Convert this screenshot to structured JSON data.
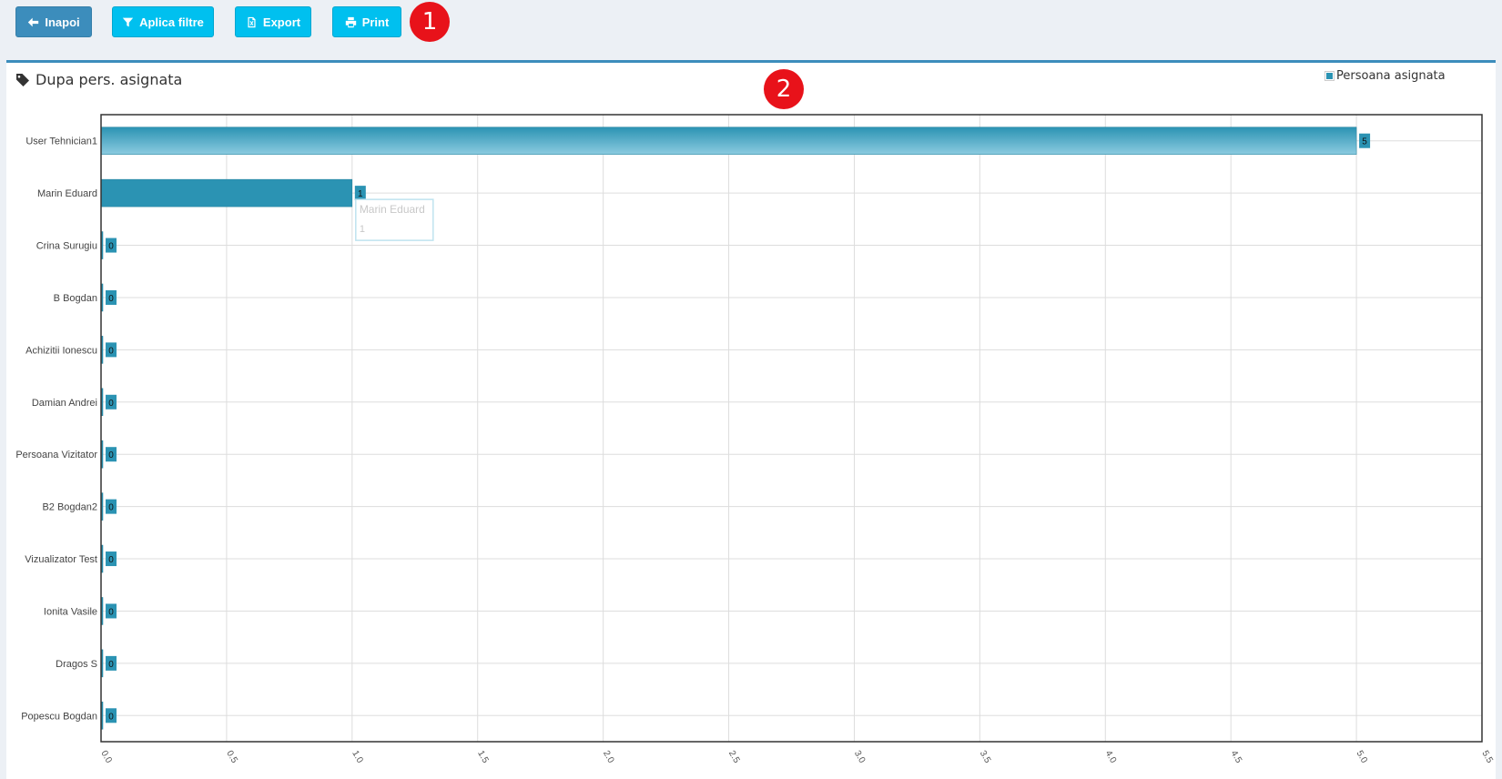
{
  "toolbar": {
    "back_label": "Inapoi",
    "filter_label": "Aplica filtre",
    "export_label": "Export",
    "print_label": "Print"
  },
  "markers": {
    "one": "1",
    "two": "2"
  },
  "box": {
    "title": "Dupa pers. asignata"
  },
  "tooltip": {
    "label": "Marin Eduard",
    "value": "1"
  },
  "colors": {
    "bar": "#2b93b3",
    "accent": "#00c0ef",
    "primary": "#3c8dbc",
    "marker": "#e8121a"
  },
  "chart_data": {
    "type": "bar",
    "orientation": "horizontal",
    "title": "Dupa pers. asignata",
    "series": [
      {
        "name": "Persoana asignata",
        "values": [
          5,
          1,
          0,
          0,
          0,
          0,
          0,
          0,
          0,
          0,
          0,
          0
        ]
      }
    ],
    "categories": [
      "User Tehnician1",
      "Marin Eduard",
      "Crina Surugiu",
      "B Bogdan",
      "Achizitii Ionescu",
      "Damian Andrei",
      "Persoana Vizitator",
      "B2 Bogdan2",
      "Vizualizator Test",
      "Ionita Vasile",
      "Dragos S",
      "Popescu Bogdan"
    ],
    "xlim": [
      0,
      5.5
    ],
    "xticks": [
      "0.0",
      "0.5",
      "1.0",
      "1.5",
      "2.0",
      "2.5",
      "3.0",
      "3.5",
      "4.0",
      "4.5",
      "5.0",
      "5.5"
    ],
    "xlabel": "",
    "ylabel": "",
    "grid": true,
    "legend": "top-right",
    "data_labels": true
  }
}
